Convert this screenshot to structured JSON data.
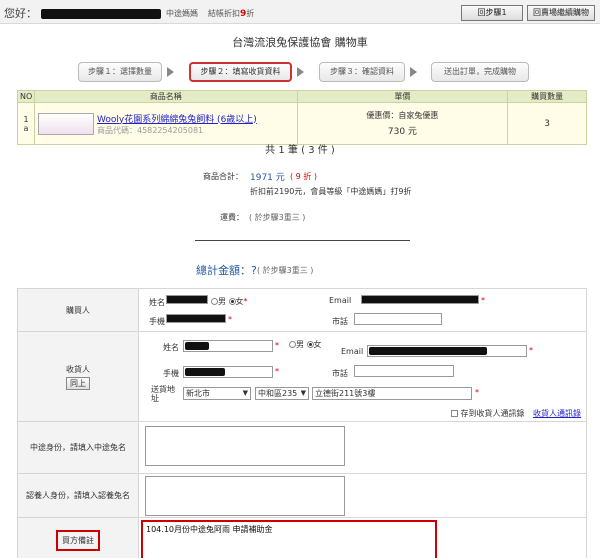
{
  "topbar": {
    "greeting": "您好：",
    "member_tag": "中途媽媽",
    "discount_prefix": "結帳折扣",
    "discount_value": "9",
    "discount_suffix": "折",
    "back_button": "回步驟1",
    "home_button": "回賣場繼續購物"
  },
  "page_title": "台灣流浪兔保護協會 購物車",
  "steps": [
    {
      "label": "步驟１：選擇數量"
    },
    {
      "label": "步驟２：填寫收貨資料"
    },
    {
      "label": "步驟３：確認資料"
    },
    {
      "label": "送出訂單，完成購物"
    }
  ],
  "product_table": {
    "headers": {
      "no": "NO",
      "name": "商品名稱",
      "price": "單價",
      "qty": "購買數量"
    },
    "rows": [
      {
        "no": "1",
        "sub": "a",
        "name": "Wooly花園系列綿綿兔兔飼料 (6歲以上)",
        "code": "商品代碼：4582254205081",
        "price_label": "優惠價：自家兔優惠",
        "price": "730 元",
        "qty": "3"
      }
    ]
  },
  "summary": {
    "count_prefix": "共",
    "count_value": "1",
    "count_mid": "筆",
    "count_qty": "( 3 件 )",
    "subtotal_label": "商品合計：",
    "subtotal_value": "1971 元",
    "subtotal_discount": "( 9 折 )",
    "subtotal_note": "折扣前2190元，會員等級「中途媽媽」打9折",
    "shipping_label": "運費：",
    "shipping_value": "( 於步驟3重三 )",
    "total_label": "總計金額：?",
    "total_note": "( 於步驟3重三 )"
  },
  "form": {
    "buyer": {
      "section_label": "購買人",
      "name_label": "姓名",
      "gender_male": "男",
      "gender_female": "女",
      "email_label": "Email",
      "mobile_label": "手機",
      "phone_label": "市話"
    },
    "receiver": {
      "section_label": "收貨人",
      "same_button": "同上",
      "name_label": "姓名",
      "gender_male": "男",
      "gender_female": "女",
      "email_label": "Email",
      "mobile_label": "手機",
      "phone_label": "市話",
      "address_label": "送貨地址",
      "city": "新北市",
      "district": "中和區235",
      "street": "立德街211號3樓",
      "save_label": "存到收貨人通訊錄",
      "addressbook_link": "收貨人通訊錄"
    },
    "halfway_label": "中途身份，請填入中途兔名",
    "adopt_label": "認養人身份，請填入認養兔名",
    "remark_label": "買方備註",
    "remark_value": "104.10月份中途兔阿雨  申請補助金"
  }
}
